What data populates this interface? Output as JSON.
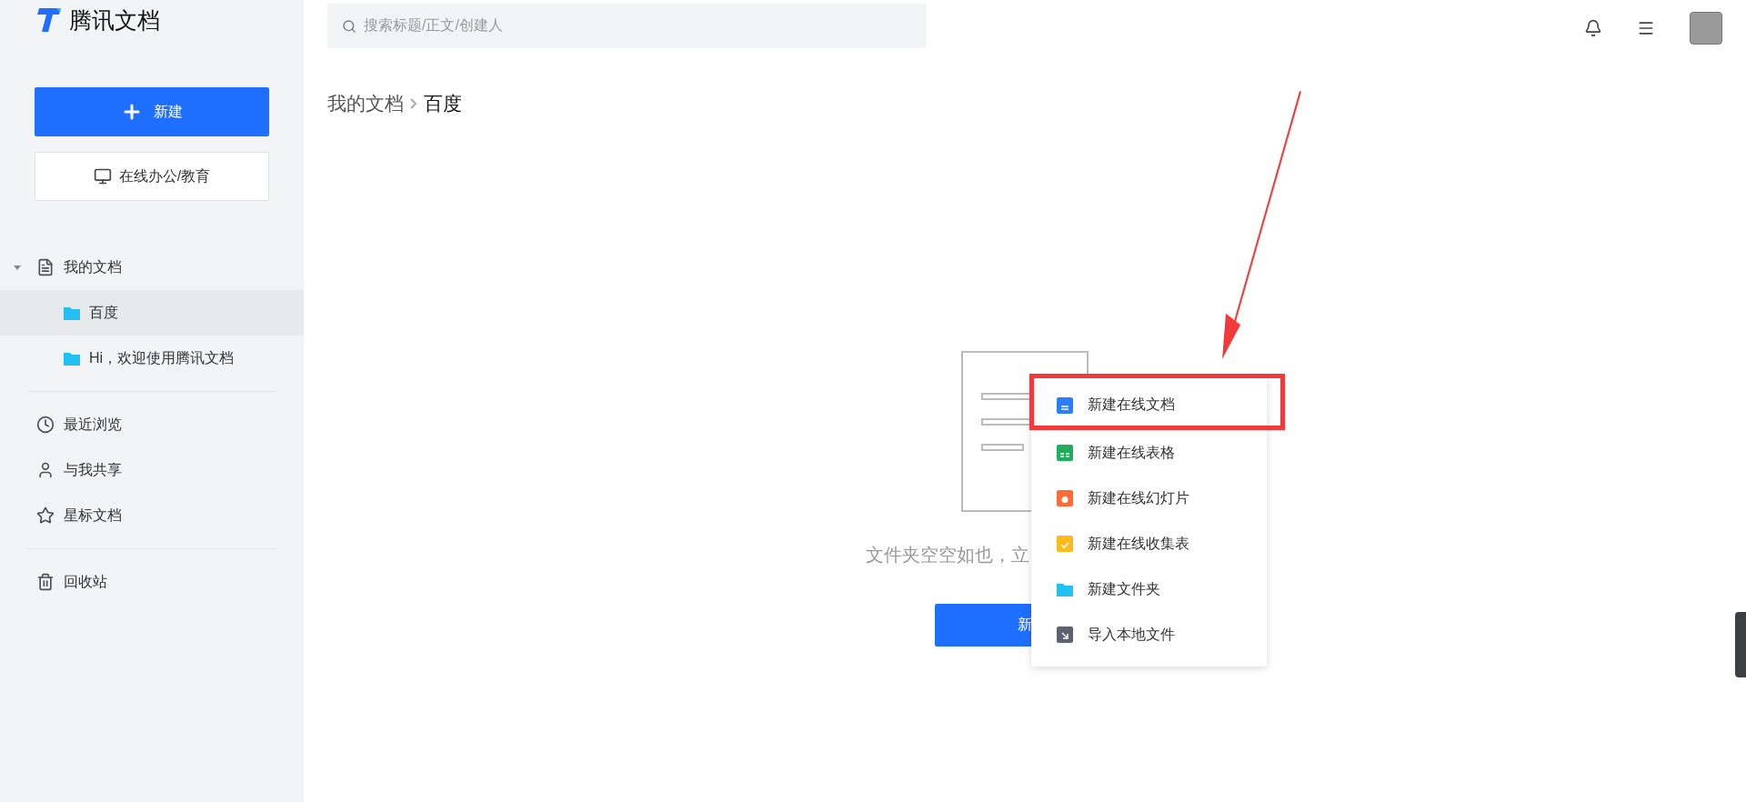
{
  "app": {
    "name": "腾讯文档"
  },
  "sidebar": {
    "new_button": "新建",
    "office_button": "在线办公/教育",
    "tree": [
      {
        "label": "我的文档",
        "expanded": true,
        "children": [
          {
            "label": "百度",
            "selected": true
          },
          {
            "label": "Hi，欢迎使用腾讯文档",
            "selected": false
          }
        ]
      }
    ],
    "groups": [
      [
        {
          "kind": "recent",
          "label": "最近浏览"
        },
        {
          "kind": "shared",
          "label": "与我共享"
        },
        {
          "kind": "starred",
          "label": "星标文档"
        }
      ],
      [
        {
          "kind": "trash",
          "label": "回收站"
        }
      ]
    ]
  },
  "search": {
    "placeholder": "搜索标题/正文/创建人"
  },
  "breadcrumb": [
    "我的文档",
    "百度"
  ],
  "empty_state": {
    "message": "文件夹空空如也，立",
    "button": "新"
  },
  "menu": {
    "items": [
      {
        "kind": "doc",
        "label": "新建在线文档",
        "highlighted": true
      },
      {
        "kind": "sheet",
        "label": "新建在线表格",
        "highlighted": false
      },
      {
        "kind": "slides",
        "label": "新建在线幻灯片",
        "highlighted": false
      },
      {
        "kind": "form",
        "label": "新建在线收集表",
        "highlighted": false
      },
      {
        "kind": "folder",
        "label": "新建文件夹",
        "highlighted": false
      },
      {
        "kind": "import",
        "label": "导入本地文件",
        "highlighted": false
      }
    ]
  }
}
